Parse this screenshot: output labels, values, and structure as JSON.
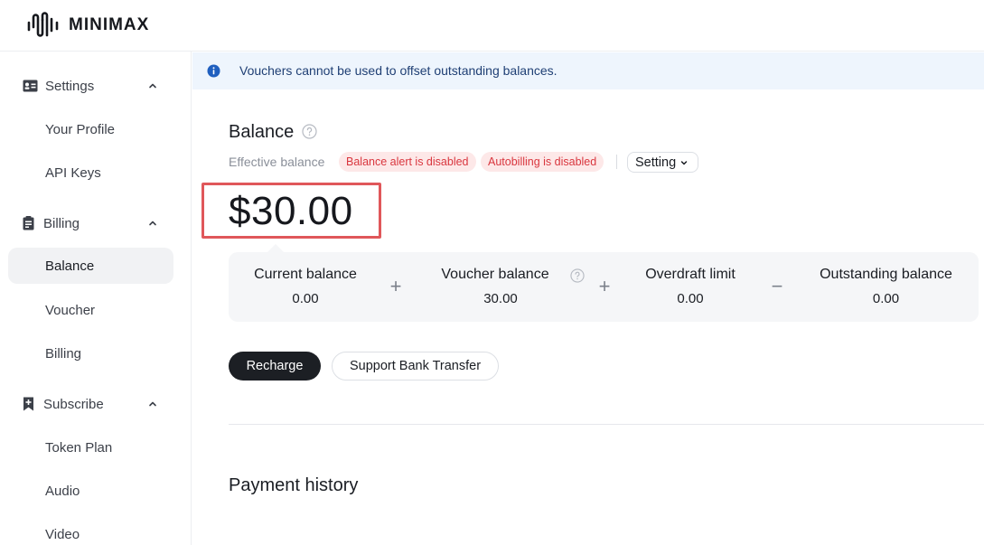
{
  "brand": {
    "name": "MINIMAX"
  },
  "sidebar": {
    "groups": [
      {
        "label": "Settings",
        "icon": "id-card-icon",
        "items": [
          {
            "label": "Your Profile"
          },
          {
            "label": "API Keys"
          }
        ]
      },
      {
        "label": "Billing",
        "icon": "clipboard-icon",
        "items": [
          {
            "label": "Balance",
            "active": true
          },
          {
            "label": "Voucher"
          },
          {
            "label": "Billing"
          }
        ]
      },
      {
        "label": "Subscribe",
        "icon": "bookmark-plus-icon",
        "items": [
          {
            "label": "Token Plan"
          },
          {
            "label": "Audio"
          },
          {
            "label": "Video"
          }
        ]
      }
    ]
  },
  "notice": {
    "text": "Vouchers cannot be used to offset outstanding balances.",
    "icon": "info-icon",
    "color": "#1f5fbf"
  },
  "balance": {
    "title": "Balance",
    "effective_label": "Effective balance",
    "tags": [
      "Balance alert is disabled",
      "Autobilling is disabled"
    ],
    "setting_label": "Setting",
    "amount": "$30.00",
    "highlight_color": "#e0575a",
    "components": [
      {
        "label": "Current balance",
        "value": "0.00"
      },
      {
        "label": "Voucher balance",
        "value": "30.00"
      },
      {
        "label": "Overdraft limit",
        "value": "0.00"
      },
      {
        "label": "Outstanding balance",
        "value": "0.00"
      }
    ],
    "operators": [
      "+",
      "+",
      "−"
    ]
  },
  "actions": {
    "recharge": "Recharge",
    "bank_transfer": "Support Bank Transfer"
  },
  "payment_history": {
    "title": "Payment history"
  }
}
